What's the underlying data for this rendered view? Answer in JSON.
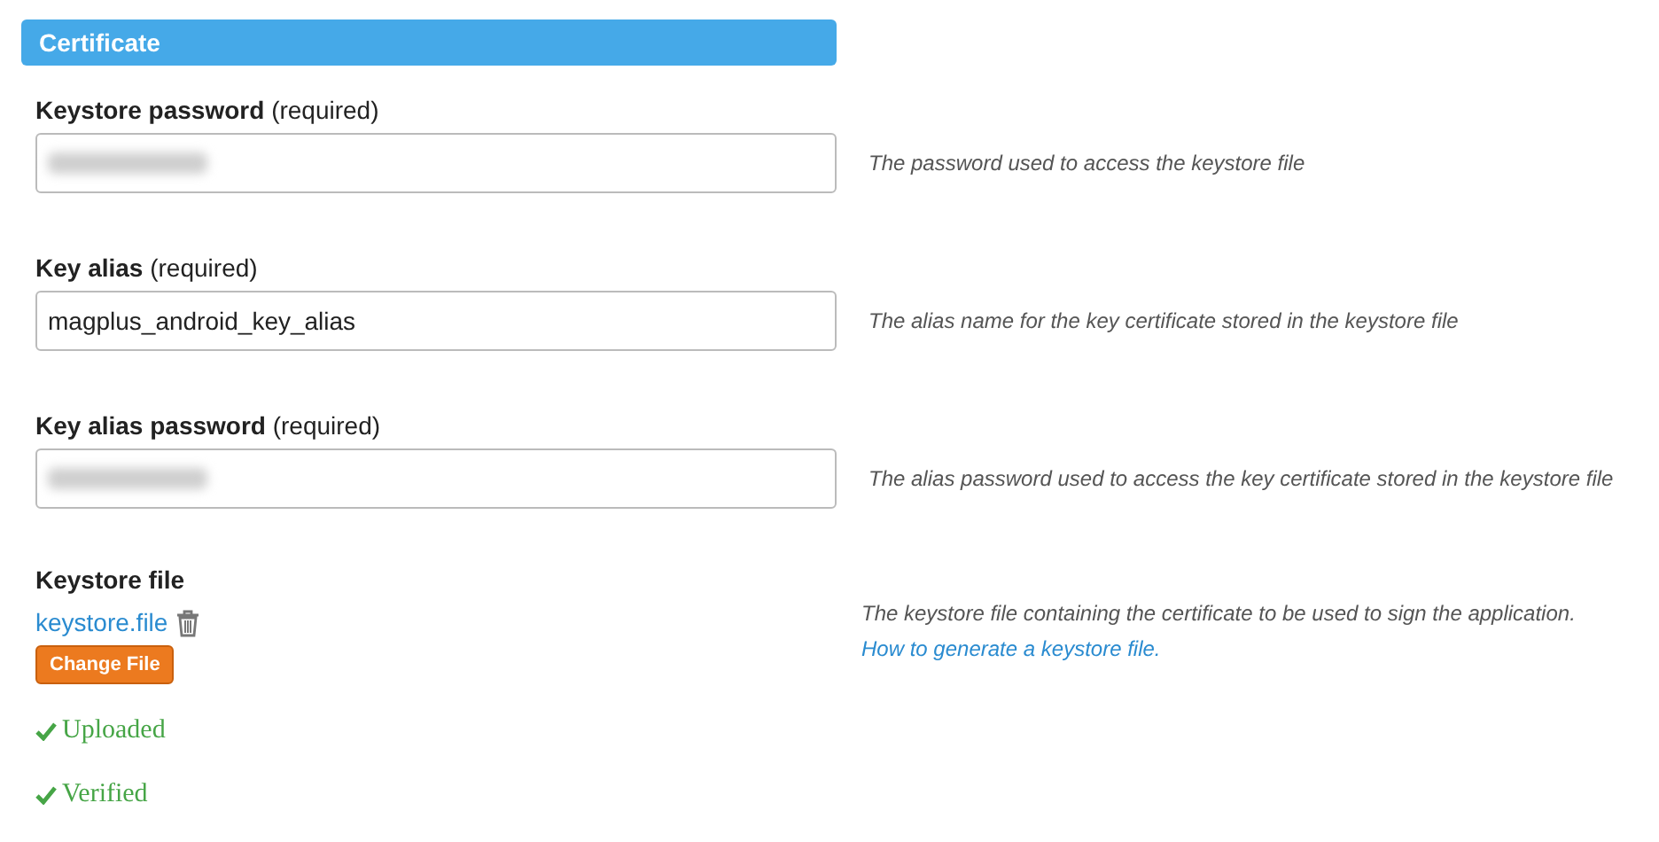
{
  "section": {
    "title": "Certificate"
  },
  "fields": [
    {
      "label": "Keystore password",
      "note": "(required)",
      "value_hidden": true,
      "help": "The password used to access the keystore file"
    },
    {
      "label": "Key alias",
      "note": "(required)",
      "value_hidden": false,
      "value": "magplus_android_key_alias",
      "help": "The alias name for the key certificate stored in the keystore file"
    },
    {
      "label": "Key alias password",
      "note": "(required)",
      "value_hidden": true,
      "help": "The alias password used to access the key certificate stored in the keystore file"
    }
  ],
  "file": {
    "label": "Keystore file",
    "filename": "keystore.file",
    "button": "Change File",
    "help": "The keystore file containing the certificate to be used to sign the application.",
    "help_link": "How to generate a keystore file."
  },
  "statuses": [
    {
      "text": "Uploaded",
      "ok": true
    },
    {
      "text": "Verified",
      "ok": true
    }
  ]
}
